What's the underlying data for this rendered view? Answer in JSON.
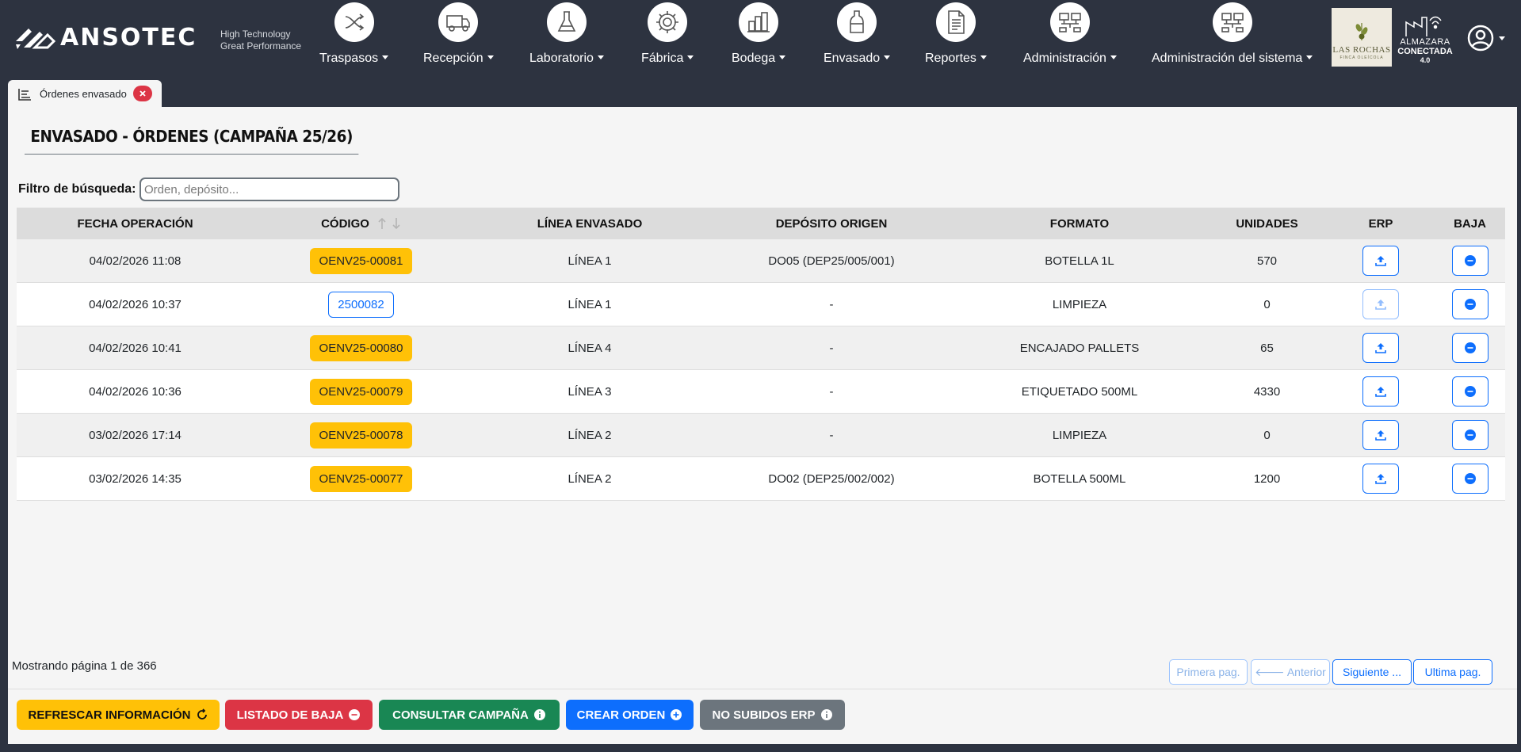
{
  "brand": {
    "name": "ANSOTEC",
    "tagline_line1": "High Technology",
    "tagline_line2": "Great Performance"
  },
  "nav": [
    {
      "label": "Traspasos",
      "icon": "arrows-cross-icon"
    },
    {
      "label": "Recepción",
      "icon": "truck-icon"
    },
    {
      "label": "Laboratorio",
      "icon": "flask-icon"
    },
    {
      "label": "Fábrica",
      "icon": "gear-icon"
    },
    {
      "label": "Bodega",
      "icon": "warehouse-tanks-icon"
    },
    {
      "label": "Envasado",
      "icon": "bottle-icon"
    },
    {
      "label": "Reportes",
      "icon": "document-icon"
    },
    {
      "label": "Administración",
      "icon": "network-computers-icon"
    },
    {
      "label": "Administración del sistema",
      "icon": "network-computers-icon"
    }
  ],
  "partner_logos": {
    "rochas_line1": "LAS ROCHAS",
    "rochas_line2": "FINCA OLEÍCOLA",
    "almazara_line1": "ALMAZARA",
    "almazara_line2": "CONECTADA",
    "almazara_line3": "4.0"
  },
  "tab": {
    "label": "Órdenes envasado"
  },
  "page": {
    "title": "ENVASADO - ÓRDENES (CAMPAÑA 25/26)",
    "filter_label": "Filtro de búsqueda:",
    "filter_placeholder": "Orden, depósito...",
    "filter_value": ""
  },
  "table": {
    "columns": [
      "FECHA OPERACIÓN",
      "CÓDIGO",
      "LÍNEA ENVASADO",
      "DEPÓSITO ORIGEN",
      "FORMATO",
      "UNIDADES",
      "ERP",
      "BAJA"
    ],
    "rows": [
      {
        "fecha": "04/02/2026 11:08",
        "codigo": "OENV25-00081",
        "linea": "LÍNEA 1",
        "deposito": "DO05 (DEP25/005/001)",
        "formato": "BOTELLA 1L",
        "unidades": "570"
      },
      {
        "fecha": "04/02/2026 10:37",
        "codigo": "2500082",
        "linea": "LÍNEA 1",
        "deposito": "-",
        "formato": "LIMPIEZA",
        "unidades": "0"
      },
      {
        "fecha": "04/02/2026 10:41",
        "codigo": "OENV25-00080",
        "linea": "LÍNEA 4",
        "deposito": "-",
        "formato": "ENCAJADO PALLETS",
        "unidades": "65"
      },
      {
        "fecha": "04/02/2026 10:36",
        "codigo": "OENV25-00079",
        "linea": "LÍNEA 3",
        "deposito": "-",
        "formato": "ETIQUETADO 500ML",
        "unidades": "4330"
      },
      {
        "fecha": "03/02/2026 17:14",
        "codigo": "OENV25-00078",
        "linea": "LÍNEA 2",
        "deposito": "-",
        "formato": "LIMPIEZA",
        "unidades": "0"
      },
      {
        "fecha": "03/02/2026 14:35",
        "codigo": "OENV25-00077",
        "linea": "LÍNEA 2",
        "deposito": "DO02 (DEP25/002/002)",
        "formato": "BOTELLA 500ML",
        "unidades": "1200"
      }
    ]
  },
  "pagination": {
    "info": "Mostrando página 1 de 366",
    "first": "Primera pag.",
    "prev": "🡐 Anterior",
    "next": "Siguiente ...",
    "last": "Ultima pag."
  },
  "actions": {
    "refresh": "REFRESCAR INFORMACIÓN",
    "bajas": "LISTADO DE BAJA",
    "campana": "CONSULTAR CAMPAÑA",
    "crear": "CREAR ORDEN",
    "no_erp": "NO SUBIDOS ERP"
  },
  "colors": {
    "navbar": "#2d3340",
    "badge": "#ffc107",
    "primary": "#0d6efd",
    "danger": "#dc3545",
    "success": "#198754",
    "secondary": "#6c757d"
  }
}
